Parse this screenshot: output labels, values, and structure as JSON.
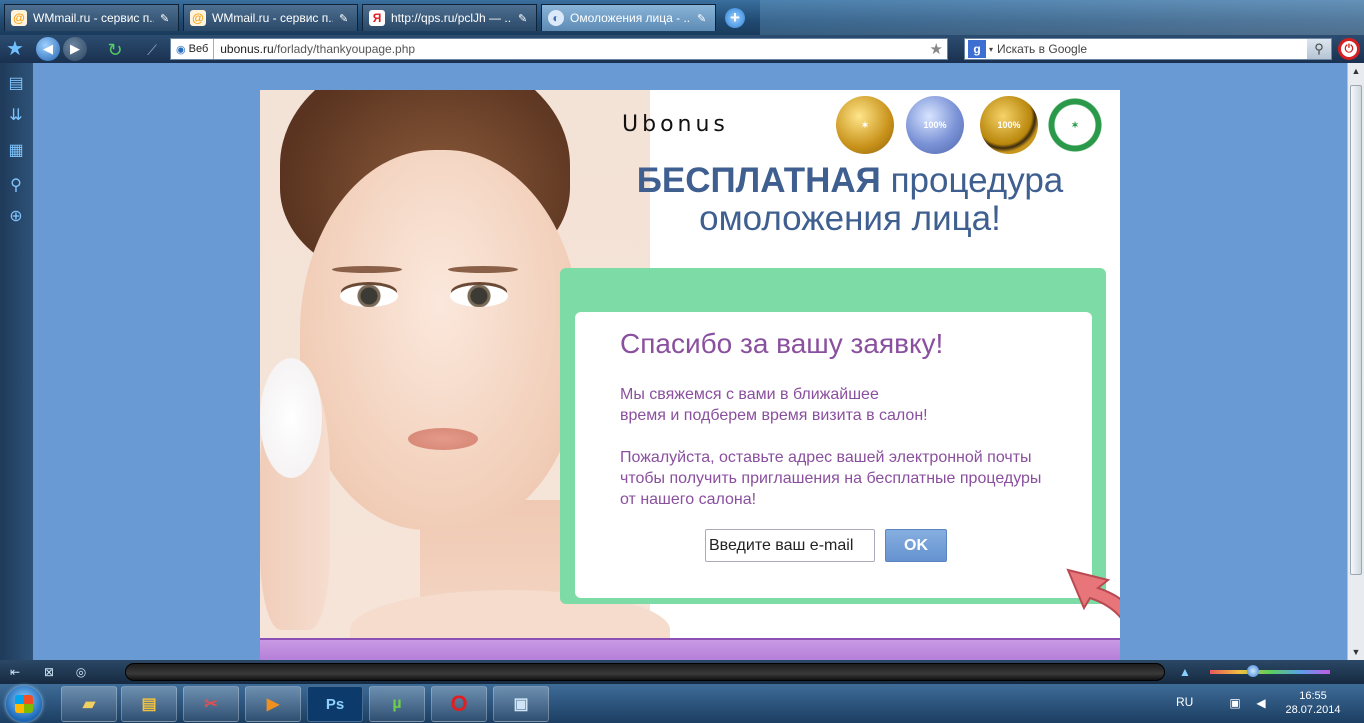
{
  "tabs": [
    {
      "title": "WMmail.ru - сервис п...",
      "icon": "at-icon"
    },
    {
      "title": "WMmail.ru - сервис п...",
      "icon": "at-icon"
    },
    {
      "title": "http://qps.ru/pclJh — ...",
      "icon": "yandex-icon"
    },
    {
      "title": "Омоложения лица - ...",
      "icon": "globe-icon"
    }
  ],
  "navbar": {
    "web_label": "Веб",
    "url_domain": "ubonus.ru",
    "url_path": "/forlady/thankyoupage.php",
    "search_placeholder": "Искать в Google"
  },
  "page": {
    "logo": "Ubonus",
    "headline_strong": "БЕСПЛАТНАЯ",
    "headline_rest_1": " процедура",
    "headline_line2": "омоложения лица!",
    "thanks_title": "Спасибо за вашу заявку!",
    "para1_line1": "Мы свяжемся с вами в ближайшее",
    "para1_line2": "время и подберем время визита в салон!",
    "para2_line1": "Пожалуйста, оставьте адрес вашей электронной почты",
    "para2_line2": "чтобы получить приглашения на бесплатные процедуры",
    "para2_line3": "от нашего салона!",
    "email_placeholder": "Введите ваш e-mail",
    "ok_label": "OK",
    "colors": {
      "headline": "#3e5f8f",
      "text": "#8a4f9e",
      "green_box": "#7ddba5",
      "button": "#6593d0"
    }
  },
  "taskbar": {
    "apps": [
      "folder-app",
      "explorer-app",
      "paint-app",
      "media-app",
      "photoshop-app",
      "utorrent-app",
      "opera-app",
      "network-app"
    ],
    "photoshop_label": "Ps",
    "lang": "RU",
    "time": "16:55",
    "date": "28.07.2014"
  }
}
